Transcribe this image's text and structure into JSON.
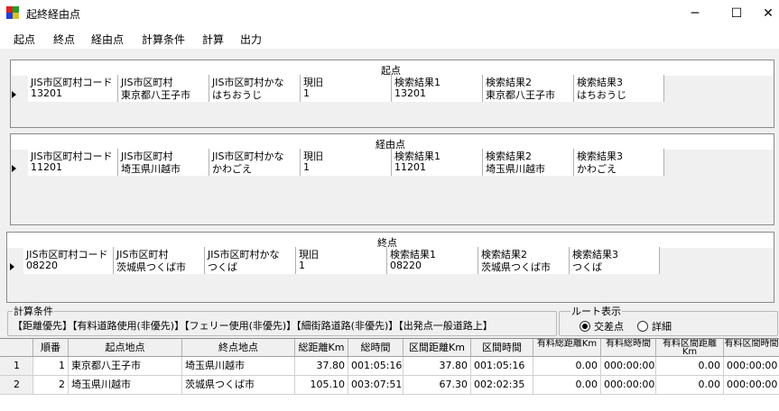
{
  "window": {
    "title": "起終経由点",
    "minimize": "─",
    "maximize": "☐",
    "close": "✕"
  },
  "menu": [
    "起点",
    "終点",
    "経由点",
    "計算条件",
    "計算",
    "出力"
  ],
  "columns": [
    "JIS市区町村コード",
    "JIS市区町村",
    "JIS市区町村かな",
    "現旧",
    "検索結果1",
    "検索結果2",
    "検索結果3"
  ],
  "panels": {
    "start": {
      "title": "起点",
      "values": [
        "13201",
        "東京都八王子市",
        "はちおうじ",
        "1",
        "13201",
        "東京都八王子市",
        "はちおうじ"
      ]
    },
    "via": {
      "title": "経由点",
      "values": [
        "11201",
        "埼玉県川越市",
        "かわごえ",
        "1",
        "11201",
        "埼玉県川越市",
        "かわごえ"
      ]
    },
    "end": {
      "title": "終点",
      "values": [
        "08220",
        "茨城県つくば市",
        "つくば",
        "1",
        "08220",
        "茨城県つくば市",
        "つくば"
      ]
    }
  },
  "conditions": {
    "legend": "計算条件",
    "text": "【距離優先】【有料道路使用(非優先)】【フェリー使用(非優先)】【細街路道路(非優先)】【出発点一般道路上】"
  },
  "route": {
    "legend": "ルート表示",
    "option1": "交差点",
    "option2": "詳細",
    "selected": "交差点"
  },
  "results": {
    "headers": [
      "順番",
      "起点地点",
      "終点地点",
      "総距離Km",
      "総時間",
      "区間距離Km",
      "区間時間",
      "有料総距離Km",
      "有料総時間",
      "有料区間距離Km",
      "有料区間時間"
    ],
    "rows": [
      {
        "rowno": "1",
        "cells": [
          "1",
          "東京都八王子市",
          "埼玉県川越市",
          "37.80",
          "001:05:16",
          "37.80",
          "001:05:16",
          "0.00",
          "000:00:00",
          "0.00",
          "000:00:00"
        ]
      },
      {
        "rowno": "2",
        "cells": [
          "2",
          "埼玉県川越市",
          "茨城県つくば市",
          "105.10",
          "003:07:51",
          "67.30",
          "002:02:35",
          "0.00",
          "000:00:00",
          "0.00",
          "000:00:00"
        ]
      }
    ]
  }
}
